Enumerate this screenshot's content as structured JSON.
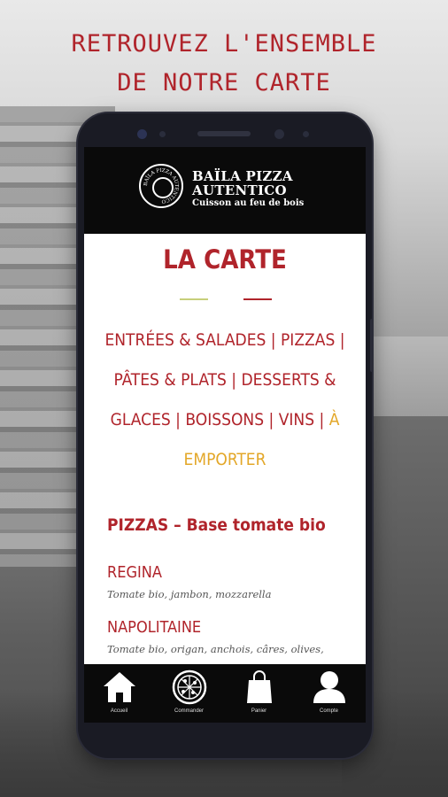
{
  "headline": {
    "line1": "RETROUVEZ L'ENSEMBLE",
    "line2": "DE NOTRE CARTE"
  },
  "brand": {
    "name_line1": "BAÏLA PIZZA",
    "name_line2": "AUTENTICO",
    "tagline": "Cuisson au feu de bois",
    "seal_text": "BAÏLA PIZZA AUTENTICO"
  },
  "page": {
    "title": "LA CARTE",
    "categories": [
      "ENTRÉES & SALADES",
      "PIZZAS",
      "PÂTES & PLATS",
      "DESSERTS & GLACES",
      "BOISSONS",
      "VINS",
      "À EMPORTER"
    ],
    "section_title": "PIZZAS – Base tomate bio",
    "items": [
      {
        "name": "REGINA",
        "desc": "Tomate bio, jambon, mozzarella"
      },
      {
        "name": "NAPOLITAINE",
        "desc": "Tomate bio, origan, anchois, câres, olives,"
      }
    ]
  },
  "tabs": [
    {
      "label": "Accueil",
      "icon": "home-icon"
    },
    {
      "label": "Commander",
      "icon": "pizza-icon"
    },
    {
      "label": "Panier",
      "icon": "shopping-bag-icon"
    },
    {
      "label": "Compte",
      "icon": "user-icon"
    }
  ],
  "colors": {
    "accent": "#b0242b",
    "highlight": "#e3a728",
    "header_bg": "#0a0a0a"
  }
}
